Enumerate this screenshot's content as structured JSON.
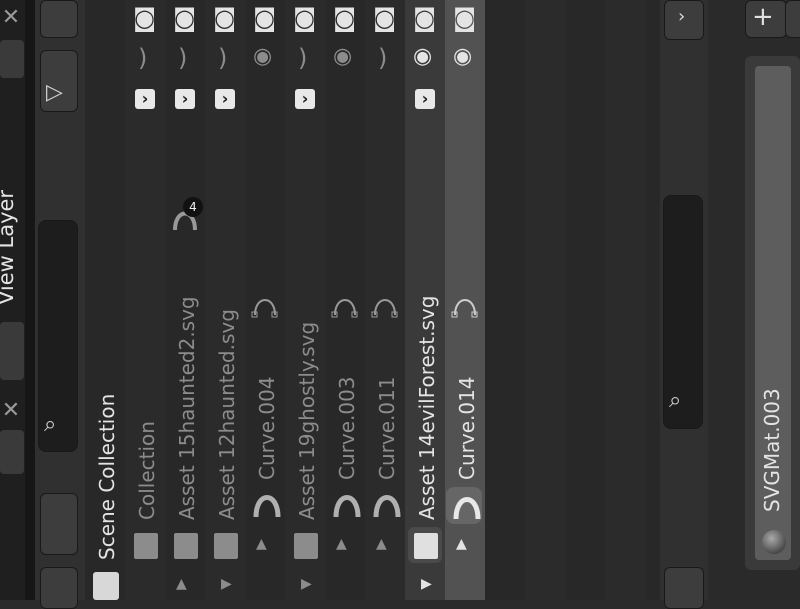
{
  "header_tabs": {
    "view_layer_label": "View Layer"
  },
  "outliner": {
    "root_label": "Scene Collection",
    "rows": [
      {
        "label": "Collection",
        "type": "collection",
        "selected": false,
        "visible": false
      },
      {
        "label": "Asset 15haunted2.svg",
        "type": "collection",
        "selected": false,
        "visible": false,
        "badge": "4"
      },
      {
        "label": "Asset 12haunted.svg",
        "type": "collection",
        "selected": false,
        "visible": false
      },
      {
        "label": "Curve.004",
        "type": "curve",
        "selected": false,
        "visible": true
      },
      {
        "label": "Asset 19ghostly.svg",
        "type": "collection",
        "selected": false,
        "visible": false
      },
      {
        "label": "Curve.003",
        "type": "curve",
        "selected": false,
        "visible": true
      },
      {
        "label": "Curve.011",
        "type": "curve",
        "selected": false,
        "visible": false
      },
      {
        "label": "Asset 14evilForest.svg",
        "type": "collection",
        "selected": true,
        "visible": true
      },
      {
        "label": "Curve.014",
        "type": "curve",
        "selected": true,
        "visible": true,
        "active": true
      }
    ]
  },
  "properties": {
    "add_symbol": "+",
    "material_slot": "SVGMat.003"
  },
  "colors": {
    "selected_row": "#525252",
    "panel_bg": "#303030",
    "checkbox": "#e8e8e8"
  }
}
